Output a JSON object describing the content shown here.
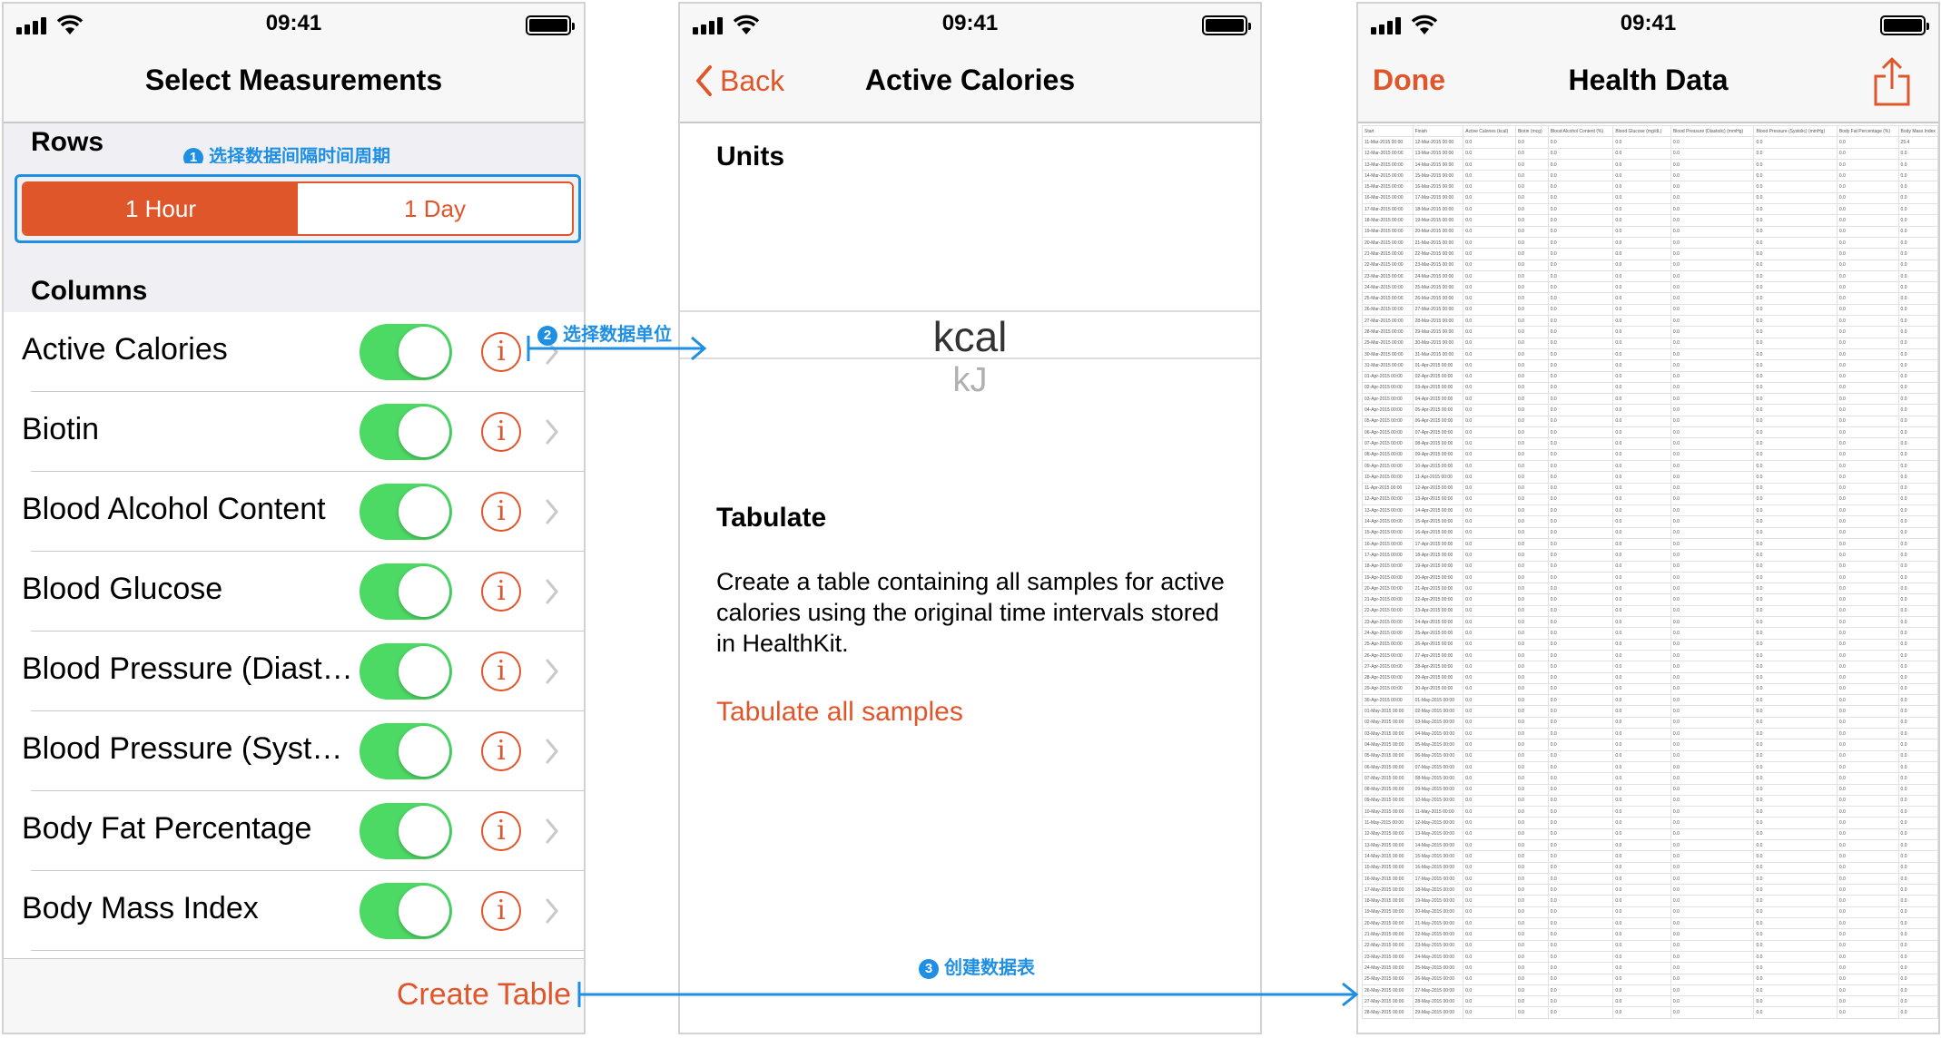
{
  "status_bar": {
    "time": "09:41"
  },
  "screen1": {
    "title": "Select Measurements",
    "rows_header": "Rows",
    "rows_hint_badge": "1",
    "rows_hint": "选择数据间隔时间周期",
    "segments": [
      "1 Hour",
      "1 Day"
    ],
    "selected_segment": "1 Hour",
    "columns_header": "Columns",
    "items": [
      {
        "label": "Active Calories",
        "enabled": true
      },
      {
        "label": "Biotin",
        "enabled": true
      },
      {
        "label": "Blood Alcohol Content",
        "enabled": true
      },
      {
        "label": "Blood Glucose",
        "enabled": true
      },
      {
        "label": "Blood Pressure (Diasto…",
        "enabled": true
      },
      {
        "label": "Blood Pressure (Systol…",
        "enabled": true
      },
      {
        "label": "Body Fat Percentage",
        "enabled": true
      },
      {
        "label": "Body Mass Index",
        "enabled": true
      }
    ],
    "info_glyph": "i",
    "create_table": "Create Table"
  },
  "screen2": {
    "back": "Back",
    "title": "Active Calories",
    "units_header": "Units",
    "unit_selected": "kcal",
    "unit_other": "kJ",
    "tabulate_header": "Tabulate",
    "tabulate_desc": "Create a table containing all samples for active calories using the original time intervals stored in HealthKit.",
    "tabulate_link": "Tabulate all samples"
  },
  "screen3": {
    "done": "Done",
    "title": "Health Data",
    "table": {
      "headers": [
        "Start",
        "Finish",
        "Active Calories (kcal)",
        "Biotin (mcg)",
        "Blood Alcohol Content (%)",
        "Blood Glucose (mg/dL)",
        "Blood Pressure (Diastolic) (mmHg)",
        "Blood Pressure (Systolic) (mmHg)",
        "Body Fat Percentage (%)",
        "Body Mass Index"
      ],
      "rows": [
        [
          "11-Mar-2015 00:00",
          "12-Mar-2015 00:00",
          "0.0",
          "0.0",
          "0.0",
          "0.0",
          "0.0",
          "0.0",
          "0.0",
          "25.4"
        ],
        [
          "12-Mar-2015 00:00",
          "13-Mar-2015 00:00",
          "0.0",
          "0.0",
          "0.0",
          "0.0",
          "0.0",
          "0.0",
          "0.0",
          "0.0"
        ],
        [
          "13-Mar-2015 00:00",
          "14-Mar-2015 00:00",
          "0.0",
          "0.0",
          "0.0",
          "0.0",
          "0.0",
          "0.0",
          "0.0",
          "0.0"
        ],
        [
          "14-Mar-2015 00:00",
          "15-Mar-2015 00:00",
          "0.0",
          "0.0",
          "0.0",
          "0.0",
          "0.0",
          "0.0",
          "0.0",
          "0.0"
        ],
        [
          "15-Mar-2015 00:00",
          "16-Mar-2015 00:00",
          "0.0",
          "0.0",
          "0.0",
          "0.0",
          "0.0",
          "0.0",
          "0.0",
          "0.0"
        ],
        [
          "16-Mar-2015 00:00",
          "17-Mar-2015 00:00",
          "0.0",
          "0.0",
          "0.0",
          "0.0",
          "0.0",
          "0.0",
          "0.0",
          "0.0"
        ],
        [
          "17-Mar-2015 00:00",
          "18-Mar-2015 00:00",
          "0.0",
          "0.0",
          "0.0",
          "0.0",
          "0.0",
          "0.0",
          "0.0",
          "0.0"
        ],
        [
          "18-Mar-2015 00:00",
          "19-Mar-2015 00:00",
          "0.0",
          "0.0",
          "0.0",
          "0.0",
          "0.0",
          "0.0",
          "0.0",
          "0.0"
        ],
        [
          "19-Mar-2015 00:00",
          "20-Mar-2015 00:00",
          "0.0",
          "0.0",
          "0.0",
          "0.0",
          "0.0",
          "0.0",
          "0.0",
          "0.0"
        ],
        [
          "20-Mar-2015 00:00",
          "21-Mar-2015 00:00",
          "0.0",
          "0.0",
          "0.0",
          "0.0",
          "0.0",
          "0.0",
          "0.0",
          "0.0"
        ],
        [
          "21-Mar-2015 00:00",
          "22-Mar-2015 00:00",
          "0.0",
          "0.0",
          "0.0",
          "0.0",
          "0.0",
          "0.0",
          "0.0",
          "0.0"
        ],
        [
          "22-Mar-2015 00:00",
          "23-Mar-2015 00:00",
          "0.0",
          "0.0",
          "0.0",
          "0.0",
          "0.0",
          "0.0",
          "0.0",
          "0.0"
        ],
        [
          "23-Mar-2015 00:00",
          "24-Mar-2015 00:00",
          "0.0",
          "0.0",
          "0.0",
          "0.0",
          "0.0",
          "0.0",
          "0.0",
          "0.0"
        ],
        [
          "24-Mar-2015 00:00",
          "25-Mar-2015 00:00",
          "0.0",
          "0.0",
          "0.0",
          "0.0",
          "0.0",
          "0.0",
          "0.0",
          "0.0"
        ],
        [
          "25-Mar-2015 00:00",
          "26-Mar-2015 00:00",
          "0.0",
          "0.0",
          "0.0",
          "0.0",
          "0.0",
          "0.0",
          "0.0",
          "0.0"
        ],
        [
          "26-Mar-2015 00:00",
          "27-Mar-2015 00:00",
          "0.0",
          "0.0",
          "0.0",
          "0.0",
          "0.0",
          "0.0",
          "0.0",
          "0.0"
        ],
        [
          "27-Mar-2015 00:00",
          "28-Mar-2015 00:00",
          "0.0",
          "0.0",
          "0.0",
          "0.0",
          "0.0",
          "0.0",
          "0.0",
          "0.0"
        ],
        [
          "28-Mar-2015 00:00",
          "29-Mar-2015 00:00",
          "0.0",
          "0.0",
          "0.0",
          "0.0",
          "0.0",
          "0.0",
          "0.0",
          "0.0"
        ],
        [
          "29-Mar-2015 00:00",
          "30-Mar-2015 00:00",
          "0.0",
          "0.0",
          "0.0",
          "0.0",
          "0.0",
          "0.0",
          "0.0",
          "0.0"
        ],
        [
          "30-Mar-2015 00:00",
          "31-Mar-2015 00:00",
          "0.0",
          "0.0",
          "0.0",
          "0.0",
          "0.0",
          "0.0",
          "0.0",
          "0.0"
        ],
        [
          "31-Mar-2015 00:00",
          "01-Apr-2015 00:00",
          "0.0",
          "0.0",
          "0.0",
          "0.0",
          "0.0",
          "0.0",
          "0.0",
          "0.0"
        ],
        [
          "01-Apr-2015 00:00",
          "02-Apr-2015 00:00",
          "0.0",
          "0.0",
          "0.0",
          "0.0",
          "0.0",
          "0.0",
          "0.0",
          "0.0"
        ],
        [
          "02-Apr-2015 00:00",
          "03-Apr-2015 00:00",
          "0.0",
          "0.0",
          "0.0",
          "0.0",
          "0.0",
          "0.0",
          "0.0",
          "0.0"
        ],
        [
          "03-Apr-2015 00:00",
          "04-Apr-2015 00:00",
          "0.0",
          "0.0",
          "0.0",
          "0.0",
          "0.0",
          "0.0",
          "0.0",
          "0.0"
        ],
        [
          "04-Apr-2015 00:00",
          "05-Apr-2015 00:00",
          "0.0",
          "0.0",
          "0.0",
          "0.0",
          "0.0",
          "0.0",
          "0.0",
          "0.0"
        ],
        [
          "05-Apr-2015 00:00",
          "06-Apr-2015 00:00",
          "0.0",
          "0.0",
          "0.0",
          "0.0",
          "0.0",
          "0.0",
          "0.0",
          "0.0"
        ],
        [
          "06-Apr-2015 00:00",
          "07-Apr-2015 00:00",
          "0.0",
          "0.0",
          "0.0",
          "0.0",
          "0.0",
          "0.0",
          "0.0",
          "0.0"
        ],
        [
          "07-Apr-2015 00:00",
          "08-Apr-2015 00:00",
          "0.0",
          "0.0",
          "0.0",
          "0.0",
          "0.0",
          "0.0",
          "0.0",
          "0.0"
        ],
        [
          "08-Apr-2015 00:00",
          "09-Apr-2015 00:00",
          "0.0",
          "0.0",
          "0.0",
          "0.0",
          "0.0",
          "0.0",
          "0.0",
          "0.0"
        ],
        [
          "09-Apr-2015 00:00",
          "10-Apr-2015 00:00",
          "0.0",
          "0.0",
          "0.0",
          "0.0",
          "0.0",
          "0.0",
          "0.0",
          "0.0"
        ],
        [
          "10-Apr-2015 00:00",
          "11-Apr-2015 00:00",
          "0.0",
          "0.0",
          "0.0",
          "0.0",
          "0.0",
          "0.0",
          "0.0",
          "0.0"
        ],
        [
          "11-Apr-2015 00:00",
          "12-Apr-2015 00:00",
          "0.0",
          "0.0",
          "0.0",
          "0.0",
          "0.0",
          "0.0",
          "0.0",
          "0.0"
        ],
        [
          "12-Apr-2015 00:00",
          "13-Apr-2015 00:00",
          "0.0",
          "0.0",
          "0.0",
          "0.0",
          "0.0",
          "0.0",
          "0.0",
          "0.0"
        ],
        [
          "13-Apr-2015 00:00",
          "14-Apr-2015 00:00",
          "0.0",
          "0.0",
          "0.0",
          "0.0",
          "0.0",
          "0.0",
          "0.0",
          "0.0"
        ],
        [
          "14-Apr-2015 00:00",
          "15-Apr-2015 00:00",
          "0.0",
          "0.0",
          "0.0",
          "0.0",
          "0.0",
          "0.0",
          "0.0",
          "0.0"
        ],
        [
          "15-Apr-2015 00:00",
          "16-Apr-2015 00:00",
          "0.0",
          "0.0",
          "0.0",
          "0.0",
          "0.0",
          "0.0",
          "0.0",
          "0.0"
        ],
        [
          "16-Apr-2015 00:00",
          "17-Apr-2015 00:00",
          "0.0",
          "0.0",
          "0.0",
          "0.0",
          "0.0",
          "0.0",
          "0.0",
          "0.0"
        ],
        [
          "17-Apr-2015 00:00",
          "18-Apr-2015 00:00",
          "0.0",
          "0.0",
          "0.0",
          "0.0",
          "0.0",
          "0.0",
          "0.0",
          "0.0"
        ],
        [
          "18-Apr-2015 00:00",
          "19-Apr-2015 00:00",
          "0.0",
          "0.0",
          "0.0",
          "0.0",
          "0.0",
          "0.0",
          "0.0",
          "0.0"
        ],
        [
          "19-Apr-2015 00:00",
          "20-Apr-2015 00:00",
          "0.0",
          "0.0",
          "0.0",
          "0.0",
          "0.0",
          "0.0",
          "0.0",
          "0.0"
        ],
        [
          "20-Apr-2015 00:00",
          "21-Apr-2015 00:00",
          "0.0",
          "0.0",
          "0.0",
          "0.0",
          "0.0",
          "0.0",
          "0.0",
          "0.0"
        ],
        [
          "21-Apr-2015 00:00",
          "22-Apr-2015 00:00",
          "0.0",
          "0.0",
          "0.0",
          "0.0",
          "0.0",
          "0.0",
          "0.0",
          "0.0"
        ],
        [
          "22-Apr-2015 00:00",
          "23-Apr-2015 00:00",
          "0.0",
          "0.0",
          "0.0",
          "0.0",
          "0.0",
          "0.0",
          "0.0",
          "0.0"
        ],
        [
          "23-Apr-2015 00:00",
          "24-Apr-2015 00:00",
          "0.0",
          "0.0",
          "0.0",
          "0.0",
          "0.0",
          "0.0",
          "0.0",
          "0.0"
        ],
        [
          "24-Apr-2015 00:00",
          "25-Apr-2015 00:00",
          "0.0",
          "0.0",
          "0.0",
          "0.0",
          "0.0",
          "0.0",
          "0.0",
          "0.0"
        ],
        [
          "25-Apr-2015 00:00",
          "26-Apr-2015 00:00",
          "0.0",
          "0.0",
          "0.0",
          "0.0",
          "0.0",
          "0.0",
          "0.0",
          "0.0"
        ],
        [
          "26-Apr-2015 00:00",
          "27-Apr-2015 00:00",
          "0.0",
          "0.0",
          "0.0",
          "0.0",
          "0.0",
          "0.0",
          "0.0",
          "0.0"
        ],
        [
          "27-Apr-2015 00:00",
          "28-Apr-2015 00:00",
          "0.0",
          "0.0",
          "0.0",
          "0.0",
          "0.0",
          "0.0",
          "0.0",
          "0.0"
        ],
        [
          "28-Apr-2015 00:00",
          "29-Apr-2015 00:00",
          "0.0",
          "0.0",
          "0.0",
          "0.0",
          "0.0",
          "0.0",
          "0.0",
          "0.0"
        ],
        [
          "29-Apr-2015 00:00",
          "30-Apr-2015 00:00",
          "0.0",
          "0.0",
          "0.0",
          "0.0",
          "0.0",
          "0.0",
          "0.0",
          "0.0"
        ],
        [
          "30-Apr-2015 00:00",
          "01-May-2015 00:00",
          "0.0",
          "0.0",
          "0.0",
          "0.0",
          "0.0",
          "0.0",
          "0.0",
          "0.0"
        ],
        [
          "01-May-2015 00:00",
          "02-May-2015 00:00",
          "0.0",
          "0.0",
          "0.0",
          "0.0",
          "0.0",
          "0.0",
          "0.0",
          "0.0"
        ],
        [
          "02-May-2015 00:00",
          "03-May-2015 00:00",
          "0.0",
          "0.0",
          "0.0",
          "0.0",
          "0.0",
          "0.0",
          "0.0",
          "0.0"
        ],
        [
          "03-May-2015 00:00",
          "04-May-2015 00:00",
          "0.0",
          "0.0",
          "0.0",
          "0.0",
          "0.0",
          "0.0",
          "0.0",
          "0.0"
        ],
        [
          "04-May-2015 00:00",
          "05-May-2015 00:00",
          "0.0",
          "0.0",
          "0.0",
          "0.0",
          "0.0",
          "0.0",
          "0.0",
          "0.0"
        ],
        [
          "05-May-2015 00:00",
          "06-May-2015 00:00",
          "0.0",
          "0.0",
          "0.0",
          "0.0",
          "0.0",
          "0.0",
          "0.0",
          "0.0"
        ],
        [
          "06-May-2015 00:00",
          "07-May-2015 00:00",
          "0.0",
          "0.0",
          "0.0",
          "0.0",
          "0.0",
          "0.0",
          "0.0",
          "0.0"
        ],
        [
          "07-May-2015 00:00",
          "08-May-2015 00:00",
          "0.0",
          "0.0",
          "0.0",
          "0.0",
          "0.0",
          "0.0",
          "0.0",
          "0.0"
        ],
        [
          "08-May-2015 00:00",
          "09-May-2015 00:00",
          "0.0",
          "0.0",
          "0.0",
          "0.0",
          "0.0",
          "0.0",
          "0.0",
          "0.0"
        ],
        [
          "09-May-2015 00:00",
          "10-May-2015 00:00",
          "0.0",
          "0.0",
          "0.0",
          "0.0",
          "0.0",
          "0.0",
          "0.0",
          "0.0"
        ],
        [
          "10-May-2015 00:00",
          "11-May-2015 00:00",
          "0.0",
          "0.0",
          "0.0",
          "0.0",
          "0.0",
          "0.0",
          "0.0",
          "0.0"
        ],
        [
          "11-May-2015 00:00",
          "12-May-2015 00:00",
          "0.0",
          "0.0",
          "0.0",
          "0.0",
          "0.0",
          "0.0",
          "0.0",
          "0.0"
        ],
        [
          "12-May-2015 00:00",
          "13-May-2015 00:00",
          "0.0",
          "0.0",
          "0.0",
          "0.0",
          "0.0",
          "0.0",
          "0.0",
          "0.0"
        ],
        [
          "13-May-2015 00:00",
          "14-May-2015 00:00",
          "0.0",
          "0.0",
          "0.0",
          "0.0",
          "0.0",
          "0.0",
          "0.0",
          "0.0"
        ],
        [
          "14-May-2015 00:00",
          "15-May-2015 00:00",
          "0.0",
          "0.0",
          "0.0",
          "0.0",
          "0.0",
          "0.0",
          "0.0",
          "0.0"
        ],
        [
          "15-May-2015 00:00",
          "16-May-2015 00:00",
          "0.0",
          "0.0",
          "0.0",
          "0.0",
          "0.0",
          "0.0",
          "0.0",
          "0.0"
        ],
        [
          "16-May-2015 00:00",
          "17-May-2015 00:00",
          "0.0",
          "0.0",
          "0.0",
          "0.0",
          "0.0",
          "0.0",
          "0.0",
          "0.0"
        ],
        [
          "17-May-2015 00:00",
          "18-May-2015 00:00",
          "0.0",
          "0.0",
          "0.0",
          "0.0",
          "0.0",
          "0.0",
          "0.0",
          "0.0"
        ],
        [
          "18-May-2015 00:00",
          "19-May-2015 00:00",
          "0.0",
          "0.0",
          "0.0",
          "0.0",
          "0.0",
          "0.0",
          "0.0",
          "0.0"
        ],
        [
          "19-May-2015 00:00",
          "20-May-2015 00:00",
          "0.0",
          "0.0",
          "0.0",
          "0.0",
          "0.0",
          "0.0",
          "0.0",
          "0.0"
        ],
        [
          "20-May-2015 00:00",
          "21-May-2015 00:00",
          "0.0",
          "0.0",
          "0.0",
          "0.0",
          "0.0",
          "0.0",
          "0.0",
          "0.0"
        ],
        [
          "21-May-2015 00:00",
          "22-May-2015 00:00",
          "0.0",
          "0.0",
          "0.0",
          "0.0",
          "0.0",
          "0.0",
          "0.0",
          "0.0"
        ],
        [
          "22-May-2015 00:00",
          "23-May-2015 00:00",
          "0.0",
          "0.0",
          "0.0",
          "0.0",
          "0.0",
          "0.0",
          "0.0",
          "0.0"
        ],
        [
          "23-May-2015 00:00",
          "24-May-2015 00:00",
          "0.0",
          "0.0",
          "0.0",
          "0.0",
          "0.0",
          "0.0",
          "0.0",
          "0.0"
        ],
        [
          "24-May-2015 00:00",
          "25-May-2015 00:00",
          "0.0",
          "0.0",
          "0.0",
          "0.0",
          "0.0",
          "0.0",
          "0.0",
          "0.0"
        ],
        [
          "25-May-2015 00:00",
          "26-May-2015 00:00",
          "0.0",
          "0.0",
          "0.0",
          "0.0",
          "0.0",
          "0.0",
          "0.0",
          "0.0"
        ],
        [
          "26-May-2015 00:00",
          "27-May-2015 00:00",
          "0.0",
          "0.0",
          "0.0",
          "0.0",
          "0.0",
          "0.0",
          "0.0",
          "0.0"
        ],
        [
          "27-May-2015 00:00",
          "28-May-2015 00:00",
          "0.0",
          "0.0",
          "0.0",
          "0.0",
          "0.0",
          "0.0",
          "0.0",
          "0.0"
        ],
        [
          "28-May-2015 00:00",
          "29-May-2015 00:00",
          "0.0",
          "0.0",
          "0.0",
          "0.0",
          "0.0",
          "0.0",
          "0.0",
          "0.0"
        ]
      ]
    }
  },
  "annotations": {
    "step2_badge": "2",
    "step2": "选择数据单位",
    "step3_badge": "3",
    "step3": "创建数据表"
  },
  "colors": {
    "accent": "#e0562b",
    "toggle_on": "#4cd964",
    "annotation": "#1e8fe3",
    "group_bg": "#efeff4"
  },
  "icons": [
    "signal-icon",
    "wifi-icon",
    "battery-icon",
    "info-icon",
    "chevron-right-icon",
    "chevron-left-icon",
    "share-icon",
    "arrow-right-icon"
  ]
}
